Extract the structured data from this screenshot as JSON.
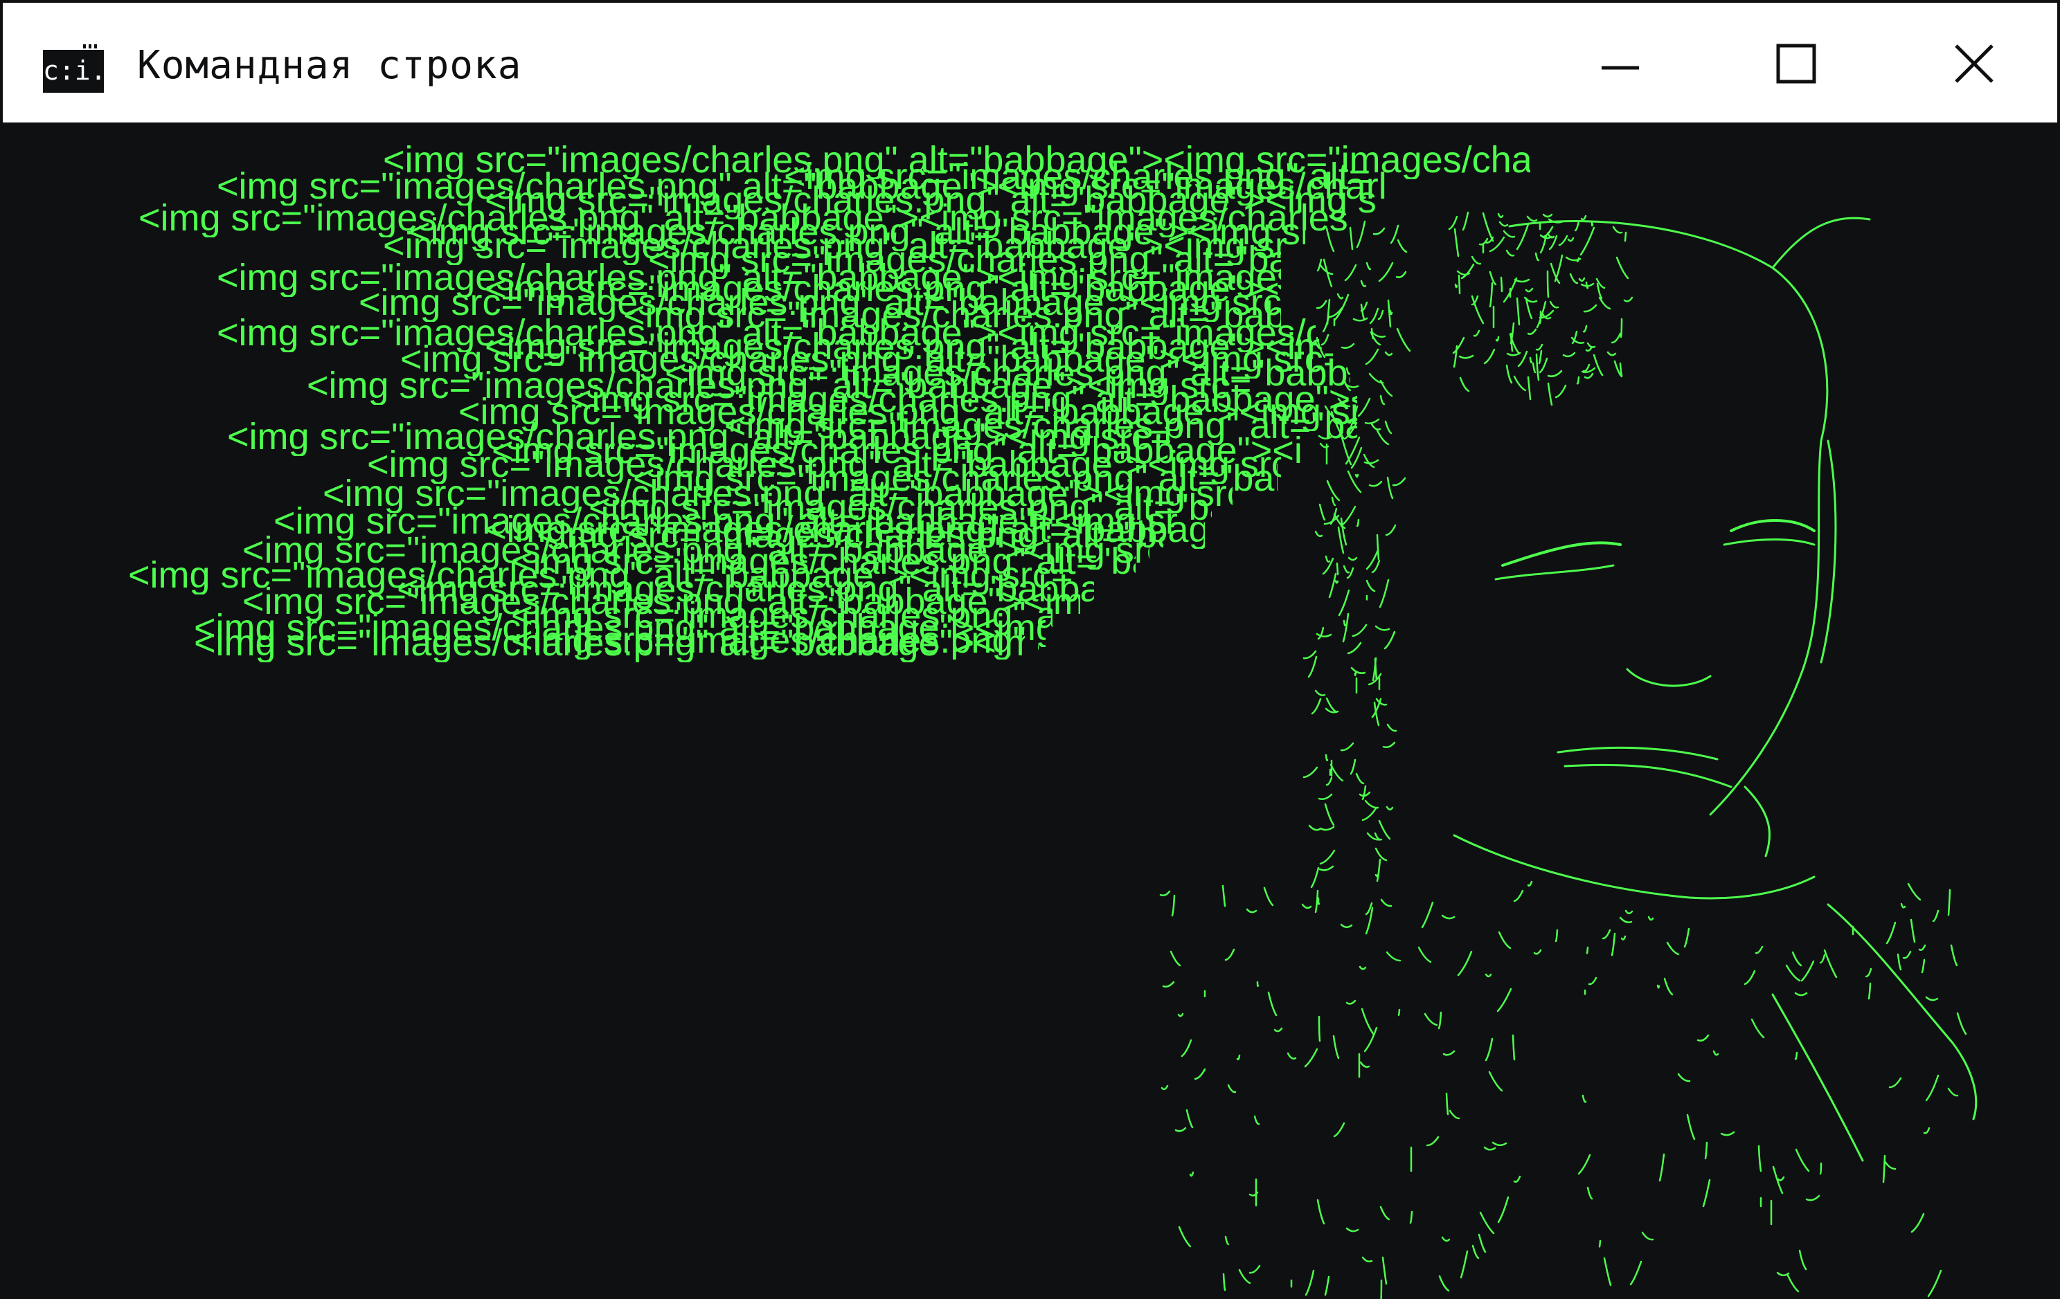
{
  "window": {
    "title": "Командная строка",
    "app_icon_glyph": "c:i.",
    "controls": {
      "minimize_icon": "minimize-icon",
      "maximize_icon": "maximize-icon",
      "close_icon": "close-icon"
    }
  },
  "console": {
    "background": "#0f1012",
    "text_color": "#4dff4d",
    "lines": [
      "<img src=\"images/charles.png\" alt=\"babbage\"><img src=\"images/charles",
      "<img src=\"images/charles.png\" alt=",
      "<img src=\"images/charles.png\" alt=\"babbage\"><img src=\"images/charles",
      "<img src=\"images/charles.png\" alt=\"babbage\"><img src=\"images/charles.png\" alt=\"babbage",
      "<img src=\"images/charles.png\" alt=\"babbage\"><img src=\"images/charles.png\" alt=\"babbage",
      "<img src=\"images/charles.png\" alt=\"babbage\"><img src=",
      "<img src=\"images/charles.png\" alt=\"babbage\"><img src=",
      "<img src=\"images/charles.png\" alt=\"babbage\"><img src=\"images/charles",
      "<img src=\"images/charles.png\" alt=\"babbage\"><img src=\"images/charles.png\" alt=\"babbage\"><img src=\"images/charles",
      "<img src=\"images/charles.png\" alt=\"babbage\"><img src=\"images/charles.png\" alt=\"babbage\"><img src=",
      "<img src=\"images/charles.png\" alt=\"babbage\"><img src=",
      "<img src=\"images/charles.png\" alt=\"babbage\"><img src=\"images/charles.png\" alt=",
      "<img src=\"images/charles.png\" alt=\"babbage\"><img src=\"images/charles",
      "<img src=\"images/charles.png\" alt=\"babbage\"><img src=\"images/charles.png\" alt=\"babbage\"><img src=\"images/charles",
      "<img src=\"images/charles.png\" alt=\"babbage\"><img src=",
      "<img src=\"images/charles.png\" alt=\"babbage\"><img src=\"images/charles.png\" alt=",
      "<img src=\"images/charles.png\" alt=\"babbage\"><img src=",
      "<img src=\"images/charles.png\" alt=\"babbage\"><img src=",
      "<img src=\"images/charles.png\" alt=\"babbage\"><img src=\"images/charles.png\"",
      "<img src=\"images/charles.png\" alt=\"babbage\"><img src=\"images/charles.png\" alt=\"babbage\"><img src=\"images/charles",
      "<img src=\"images/charles.png\" alt=\"babbage\"><img src=",
      "<img src=\"images/charles.png\" alt=\"babbage\"><img src=\"images/charles.png\" alt=\"babbage\"><img src=\"images/charles",
      "<img src=\"images/charles.png\" alt=\"babbage\"><img src=",
      "<img src=\"images/charles.png\" alt=\"babbage\"><img src=\"images/charles.png\" alt=",
      "<img src=\"images/charles.png\" alt=\"babbage\"><img src=",
      "<img src=\"images/charles.png\" alt=\"babbage\"><img src=\"images/charles.png\"",
      "<img src=\"images/charles.png\" alt=\"babbage\"><img src=",
      "<img src=\"images/charles.png\" alt=\"babbage\"><img src=\"images/charles.png\"",
      "<img src=\"images/charles.png\" alt=\"babbage\"><img src=",
      "<img src=\"images/charles.png\" alt=\"babbage\"><img src=\"images/charles.png\"",
      "<img src=\"images/charles.png\" alt=\"babbage\"><img src=",
      "<img src=\"images/charles.png\" alt=\"babbage\"><img src=\"images/charles.png\"",
      "<img src=\"images/charles.png\" alt=\"babbage\"><img src=\"images/charles",
      "<img src=\"images/charles.png\" alt=\"babbage\"><img src=",
      "<img src=\"images/charles.png\" alt=\"babbage\"><img src=\"images/charles.png\"",
      "<img src=\"images/charles.png\" alt=\"babbage\"><img src=",
      "<img src=\"images/charles.png\" alt=\"babbage\"><img src=\"images/charles.png\"",
      "<img src=\"images/charles.png\" alt=\"babbage\"><img src=\"images/charles.png\""
    ]
  }
}
